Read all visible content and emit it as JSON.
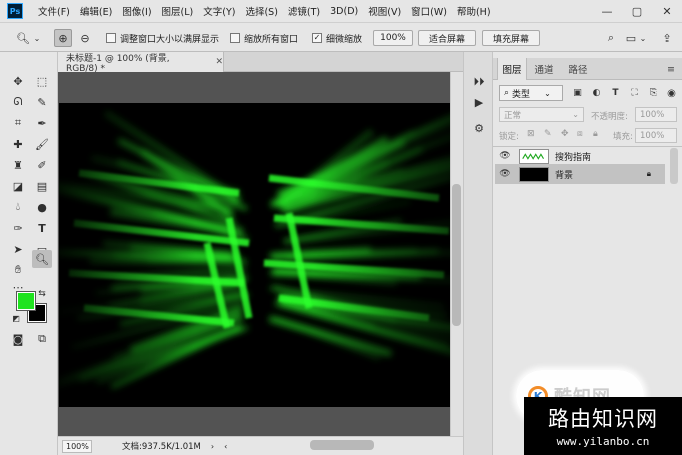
{
  "app": {
    "logo": "Ps"
  },
  "menu": [
    "文件(F)",
    "编辑(E)",
    "图像(I)",
    "图层(L)",
    "文字(Y)",
    "选择(S)",
    "滤镜(T)",
    "3D(D)",
    "视图(V)",
    "窗口(W)",
    "帮助(H)"
  ],
  "options_bar": {
    "resize_windows": "调整窗口大小以满屏显示",
    "zoom_all": "缩放所有窗口",
    "scrubby_zoom": "细微缩放",
    "btn_100": "100%",
    "btn_fit": "适合屏幕",
    "btn_fill": "填充屏幕"
  },
  "document": {
    "tab_title": "未标题-1 @ 100% (背景, RGB/8) *",
    "zoom": "100%",
    "doc_info": "文档:937.5K/1.01M"
  },
  "colors": {
    "foreground": "#1fe31f",
    "background": "#000000",
    "glow": "#2bff2b"
  },
  "layers_panel": {
    "tabs": [
      "图层",
      "通道",
      "路径"
    ],
    "filter_kind": "类型",
    "blend_mode": "正常",
    "opacity_label": "不透明度:",
    "opacity_value": "100%",
    "lock_label": "锁定:",
    "fill_label": "填充:",
    "fill_value": "100%",
    "layers": [
      {
        "name": "搜狗指南",
        "selected": false,
        "locked": false
      },
      {
        "name": "背景",
        "selected": true,
        "locked": true
      }
    ]
  },
  "watermarks": {
    "top_logo": "K",
    "top_text": "酷知网",
    "bottom_title": "路由知识网",
    "bottom_url": "www.yilanbo.cn"
  }
}
